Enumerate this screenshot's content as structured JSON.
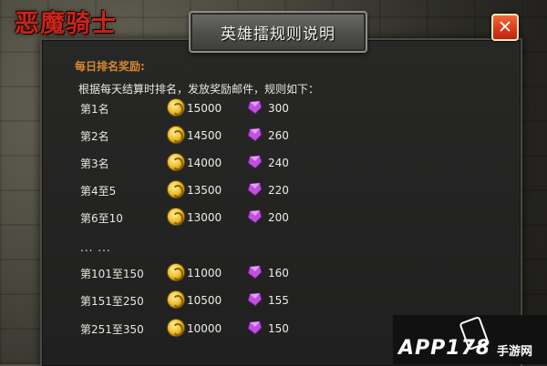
{
  "game_logo": "恶魔骑士",
  "dialog": {
    "title": "英雄擂规则说明",
    "close_symbol": "✕",
    "section_title": "每日排名奖励:",
    "intro": "根据每天结算时排名，发放奖励邮件，规则如下：",
    "ellipsis": "... ...",
    "rewards_top": [
      {
        "rank": "第1名",
        "gold": "15000",
        "gems": "300"
      },
      {
        "rank": "第2名",
        "gold": "14500",
        "gems": "260"
      },
      {
        "rank": "第3名",
        "gold": "14000",
        "gems": "240"
      },
      {
        "rank": "第4至5",
        "gold": "13500",
        "gems": "220"
      },
      {
        "rank": "第6至10",
        "gold": "13000",
        "gems": "200"
      }
    ],
    "rewards_bottom": [
      {
        "rank": "第101至150",
        "gold": "11000",
        "gems": "160"
      },
      {
        "rank": "第151至250",
        "gold": "10500",
        "gems": "155"
      },
      {
        "rank": "第251至350",
        "gold": "10000",
        "gems": "150"
      }
    ],
    "icons": {
      "gold": "gold-coin-icon",
      "gems": "purple-gem-icon"
    },
    "colors": {
      "section_title": "#d7892e",
      "close_button": "#d9371b",
      "gem": "#c24fe0",
      "coin": "#f2c230"
    }
  },
  "watermark": {
    "brand": "APP178",
    "suffix": "手游网"
  }
}
